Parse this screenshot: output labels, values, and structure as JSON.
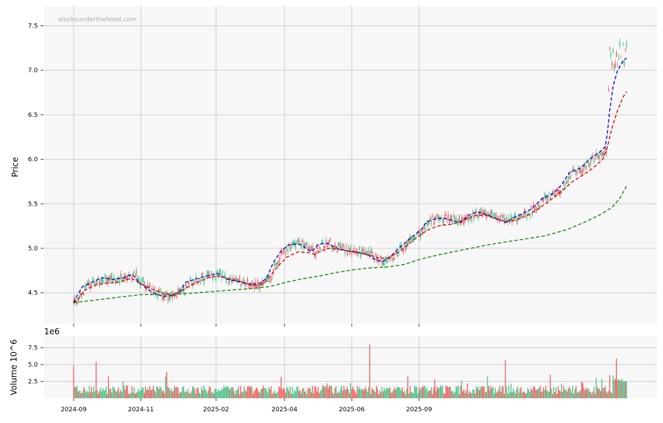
{
  "watermark": "stocksunderthehood.com",
  "colors": {
    "up": "#3fbf7f",
    "down": "#f25454",
    "ema_fast": "#0000dd",
    "ema_slow": "#dd0000",
    "ma_long": "#118811",
    "grid": "#cccccc",
    "panel_bg": "#f7f7f7"
  },
  "chart_data": [
    {
      "type": "candlestick",
      "ylabel": "Price",
      "ylim": [
        4.15,
        7.72
      ],
      "yticks": [
        "4.5",
        "5.0",
        "5.5",
        "6.0",
        "6.5",
        "7.0",
        "7.5"
      ],
      "xticks": [
        "2024-09",
        "2024-11",
        "2025-02",
        "2025-04",
        "2025-06",
        "2025-09"
      ],
      "grid": true,
      "series": [
        {
          "style": "dashed",
          "color": "ema_fast",
          "points": [
            [
              0,
              4.39
            ],
            [
              4,
              4.49
            ],
            [
              8,
              4.57
            ],
            [
              15,
              4.61
            ],
            [
              25,
              4.67
            ],
            [
              35,
              4.65
            ],
            [
              45,
              4.67
            ],
            [
              52,
              4.71
            ],
            [
              58,
              4.62
            ],
            [
              65,
              4.55
            ],
            [
              72,
              4.49
            ],
            [
              80,
              4.46
            ],
            [
              88,
              4.47
            ],
            [
              95,
              4.52
            ],
            [
              100,
              4.62
            ],
            [
              110,
              4.66
            ],
            [
              120,
              4.69
            ],
            [
              128,
              4.72
            ],
            [
              135,
              4.66
            ],
            [
              145,
              4.63
            ],
            [
              155,
              4.6
            ],
            [
              165,
              4.6
            ],
            [
              172,
              4.66
            ],
            [
              178,
              4.84
            ],
            [
              185,
              4.97
            ],
            [
              192,
              5.04
            ],
            [
              200,
              5.05
            ],
            [
              205,
              5.02
            ],
            [
              212,
              4.96
            ],
            [
              218,
              5.04
            ],
            [
              225,
              5.06
            ],
            [
              235,
              5.0
            ],
            [
              245,
              4.97
            ],
            [
              255,
              4.95
            ],
            [
              262,
              4.93
            ],
            [
              268,
              4.88
            ],
            [
              275,
              4.85
            ],
            [
              282,
              4.9
            ],
            [
              290,
              5.0
            ],
            [
              300,
              5.11
            ],
            [
              310,
              5.21
            ],
            [
              315,
              5.3
            ],
            [
              322,
              5.33
            ],
            [
              330,
              5.34
            ],
            [
              338,
              5.31
            ],
            [
              345,
              5.29
            ],
            [
              352,
              5.37
            ],
            [
              360,
              5.41
            ],
            [
              370,
              5.37
            ],
            [
              378,
              5.33
            ],
            [
              385,
              5.29
            ],
            [
              392,
              5.34
            ],
            [
              400,
              5.39
            ],
            [
              408,
              5.44
            ],
            [
              418,
              5.56
            ],
            [
              428,
              5.62
            ],
            [
              435,
              5.71
            ],
            [
              442,
              5.85
            ],
            [
              452,
              5.9
            ],
            [
              460,
              6.0
            ],
            [
              468,
              6.07
            ],
            [
              474,
              6.14
            ],
            [
              476,
              6.3
            ],
            [
              478,
              6.55
            ],
            [
              481,
              6.82
            ],
            [
              485,
              7.0
            ],
            [
              490,
              7.1
            ],
            [
              493,
              7.14
            ]
          ]
        },
        {
          "style": "dashed",
          "color": "ema_slow",
          "points": [
            [
              0,
              4.38
            ],
            [
              5,
              4.45
            ],
            [
              10,
              4.53
            ],
            [
              20,
              4.59
            ],
            [
              30,
              4.61
            ],
            [
              40,
              4.62
            ],
            [
              48,
              4.65
            ],
            [
              52,
              4.66
            ],
            [
              60,
              4.6
            ],
            [
              70,
              4.54
            ],
            [
              80,
              4.5
            ],
            [
              90,
              4.47
            ],
            [
              100,
              4.55
            ],
            [
              110,
              4.62
            ],
            [
              120,
              4.67
            ],
            [
              128,
              4.69
            ],
            [
              138,
              4.66
            ],
            [
              148,
              4.63
            ],
            [
              158,
              4.59
            ],
            [
              165,
              4.58
            ],
            [
              172,
              4.63
            ],
            [
              180,
              4.77
            ],
            [
              190,
              4.9
            ],
            [
              200,
              4.96
            ],
            [
              210,
              4.95
            ],
            [
              215,
              4.93
            ],
            [
              220,
              4.97
            ],
            [
              228,
              5.0
            ],
            [
              240,
              4.98
            ],
            [
              255,
              4.95
            ],
            [
              265,
              4.92
            ],
            [
              272,
              4.89
            ],
            [
              280,
              4.89
            ],
            [
              290,
              4.96
            ],
            [
              300,
              5.06
            ],
            [
              310,
              5.16
            ],
            [
              318,
              5.22
            ],
            [
              328,
              5.26
            ],
            [
              338,
              5.27
            ],
            [
              348,
              5.32
            ],
            [
              358,
              5.37
            ],
            [
              368,
              5.37
            ],
            [
              378,
              5.32
            ],
            [
              388,
              5.3
            ],
            [
              395,
              5.32
            ],
            [
              405,
              5.37
            ],
            [
              415,
              5.45
            ],
            [
              425,
              5.54
            ],
            [
              435,
              5.64
            ],
            [
              445,
              5.75
            ],
            [
              455,
              5.83
            ],
            [
              463,
              5.9
            ],
            [
              472,
              6.0
            ],
            [
              476,
              6.14
            ],
            [
              480,
              6.35
            ],
            [
              485,
              6.55
            ],
            [
              490,
              6.7
            ],
            [
              493,
              6.76
            ]
          ]
        },
        {
          "style": "dashed",
          "color": "ma_long",
          "points": [
            [
              0,
              4.39
            ],
            [
              20,
              4.42
            ],
            [
              40,
              4.45
            ],
            [
              60,
              4.48
            ],
            [
              80,
              4.48
            ],
            [
              100,
              4.49
            ],
            [
              120,
              4.51
            ],
            [
              140,
              4.53
            ],
            [
              160,
              4.55
            ],
            [
              175,
              4.57
            ],
            [
              190,
              4.62
            ],
            [
              205,
              4.66
            ],
            [
              220,
              4.69
            ],
            [
              235,
              4.73
            ],
            [
              250,
              4.76
            ],
            [
              265,
              4.78
            ],
            [
              280,
              4.79
            ],
            [
              295,
              4.82
            ],
            [
              310,
              4.88
            ],
            [
              330,
              4.94
            ],
            [
              350,
              4.99
            ],
            [
              370,
              5.04
            ],
            [
              390,
              5.08
            ],
            [
              405,
              5.11
            ],
            [
              420,
              5.14
            ],
            [
              440,
              5.21
            ],
            [
              455,
              5.29
            ],
            [
              470,
              5.38
            ],
            [
              480,
              5.46
            ],
            [
              487,
              5.56
            ],
            [
              493,
              5.7
            ]
          ]
        }
      ]
    },
    {
      "type": "bar",
      "ylabel": "Volume  10^6",
      "scale_label": "1e6",
      "ylim": [
        0,
        9.2
      ],
      "yticks": [
        "2.5",
        "5.0",
        "7.5"
      ],
      "grid": true
    }
  ]
}
